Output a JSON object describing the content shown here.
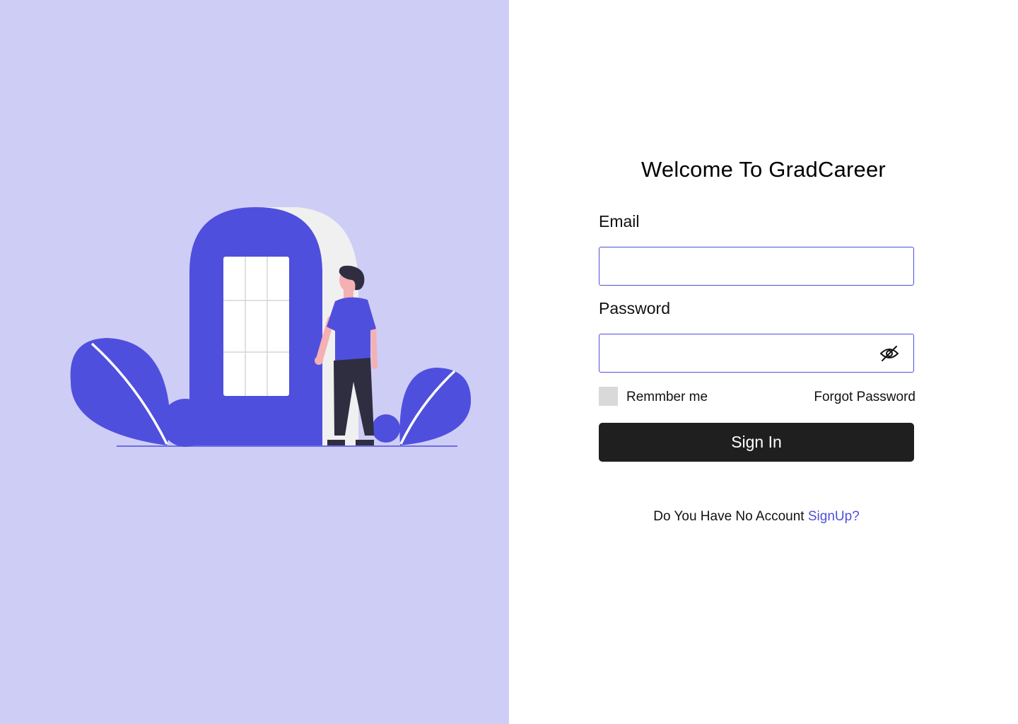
{
  "login": {
    "title": "Welcome To GradCareer",
    "email_label": "Email",
    "email_value": "",
    "password_label": "Password",
    "password_value": "",
    "remember_label": "Remmber me",
    "remember_checked": false,
    "forgot_label": "Forgot Password",
    "signin_label": "Sign In",
    "signup_prompt": "Do You Have No Account",
    "signup_link": "SignUp?"
  },
  "icons": {
    "password_toggle": "eye-off-icon"
  },
  "colors": {
    "left_panel_bg": "#cecdf5",
    "accent": "#4f4fde",
    "button_bg": "#1f1f1f",
    "checkbox_bg": "#d9d9d9"
  }
}
